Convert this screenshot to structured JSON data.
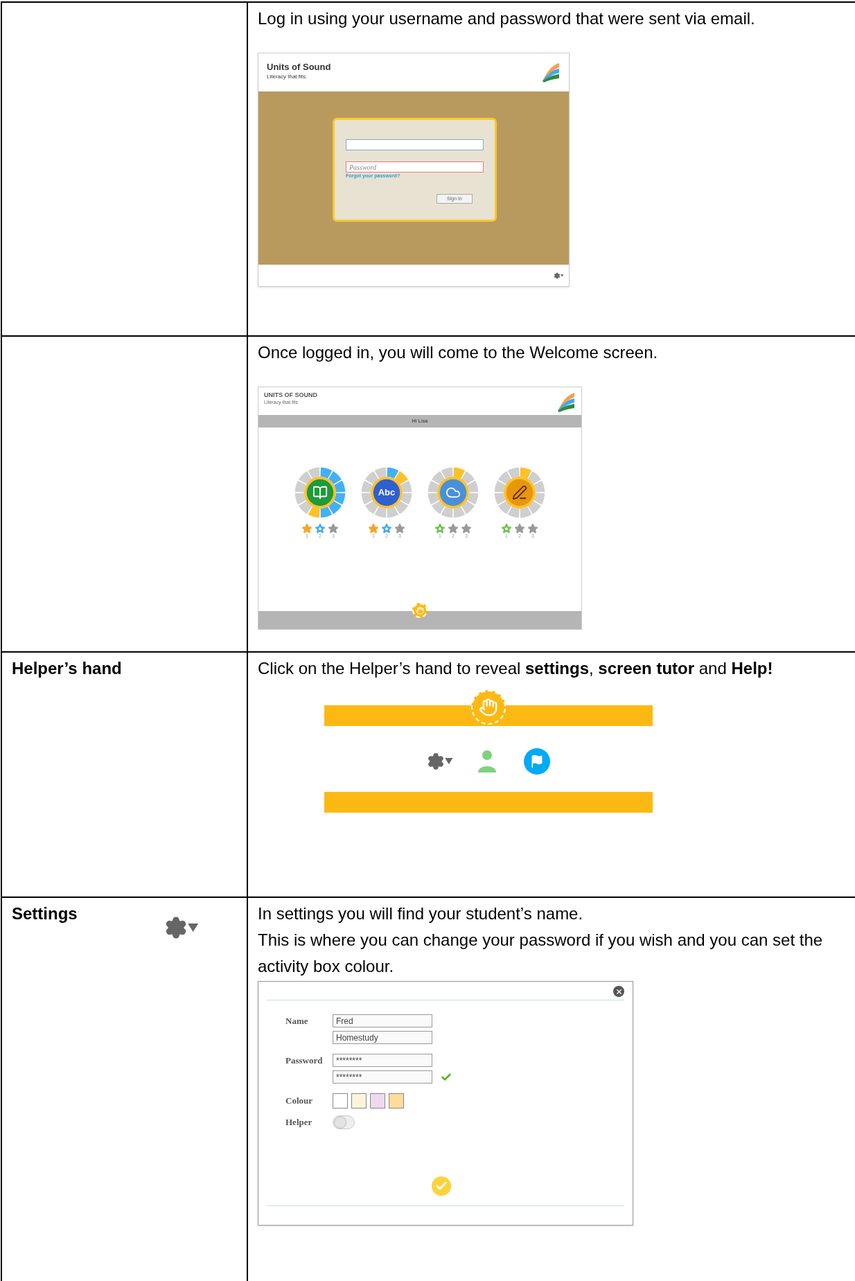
{
  "rows": [
    {
      "kind": "login",
      "text": "Log in using your username and password that were sent via email.",
      "screenshot": {
        "title": "Units of Sound",
        "tagline": "Literacy that fits.",
        "password_placeholder": "Password",
        "forgot_link": "Forgot your password?",
        "sign_in_button": "Sign In"
      }
    },
    {
      "kind": "welcome",
      "text": "Once logged in, you will come to the Welcome screen.",
      "screenshot": {
        "title": "UNITS OF SOUND",
        "tagline": "Literacy that fits",
        "greeting": "Hi Lisa",
        "activities": [
          {
            "kind": "book",
            "ring_segments": [
              {
                "color": "#42b0f5"
              },
              {
                "color": "#42b0f5"
              },
              {
                "color": "#42b0f5"
              },
              {
                "color": "#42b0f5"
              },
              {
                "color": "#42b0f5"
              },
              {
                "color": "#42b0f5"
              },
              {
                "color": "#fdc12a"
              }
            ],
            "stars": [
              {
                "number": "1",
                "color": "#f5a623",
                "filled": true
              },
              {
                "number": "2",
                "color": "#3fa9f5",
                "filled": false
              },
              {
                "number": "3",
                "color": "#9a9a9a",
                "filled": true
              }
            ]
          },
          {
            "kind": "abc",
            "icon_text": "Abc",
            "ring_segments": [
              {
                "color": "#42b0f5"
              },
              {
                "color": "#fdc12a"
              }
            ],
            "stars": [
              {
                "number": "1",
                "color": "#f5a623",
                "filled": true
              },
              {
                "number": "2",
                "color": "#3fa9f5",
                "filled": false
              },
              {
                "number": "3",
                "color": "#9a9a9a",
                "filled": true
              }
            ]
          },
          {
            "kind": "speech",
            "ring_segments": [
              {
                "color": "#fdc12a"
              }
            ],
            "stars": [
              {
                "number": "1",
                "color": "#6cc24a",
                "filled": false
              },
              {
                "number": "2",
                "color": "#9a9a9a",
                "filled": true
              },
              {
                "number": "3",
                "color": "#9a9a9a",
                "filled": true
              }
            ]
          },
          {
            "kind": "pen",
            "ring_segments": [
              {
                "color": "#fdc12a"
              }
            ],
            "stars": [
              {
                "number": "1",
                "color": "#6cc24a",
                "filled": false
              },
              {
                "number": "2",
                "color": "#9a9a9a",
                "filled": true
              },
              {
                "number": "3",
                "color": "#9a9a9a",
                "filled": true
              }
            ]
          }
        ]
      }
    },
    {
      "kind": "helper",
      "label": "Helper’s hand",
      "text": "Click on the Helper’s hand to reveal **settings**, **screen tutor** and **Help!**"
    },
    {
      "kind": "settings",
      "label": "Settings",
      "paragraphs": [
        "In settings you will find your student’s name.",
        "This is where you can change your password if you wish and you can set the activity box colour."
      ],
      "dialog": {
        "fields": [
          {
            "label": "Name",
            "values": [
              "Fred",
              "Homestudy"
            ],
            "confirmed": false
          },
          {
            "label": "Password",
            "values": [
              "********",
              "********"
            ],
            "confirmed": true
          }
        ],
        "colour_label": "Colour",
        "swatches": [
          {
            "color": "#ffffff"
          },
          {
            "color": "#fff3dc"
          },
          {
            "color": "#efd9ef"
          },
          {
            "color": "#ffdb9c"
          }
        ],
        "helper_label": "Helper",
        "helper_on": false
      }
    }
  ]
}
